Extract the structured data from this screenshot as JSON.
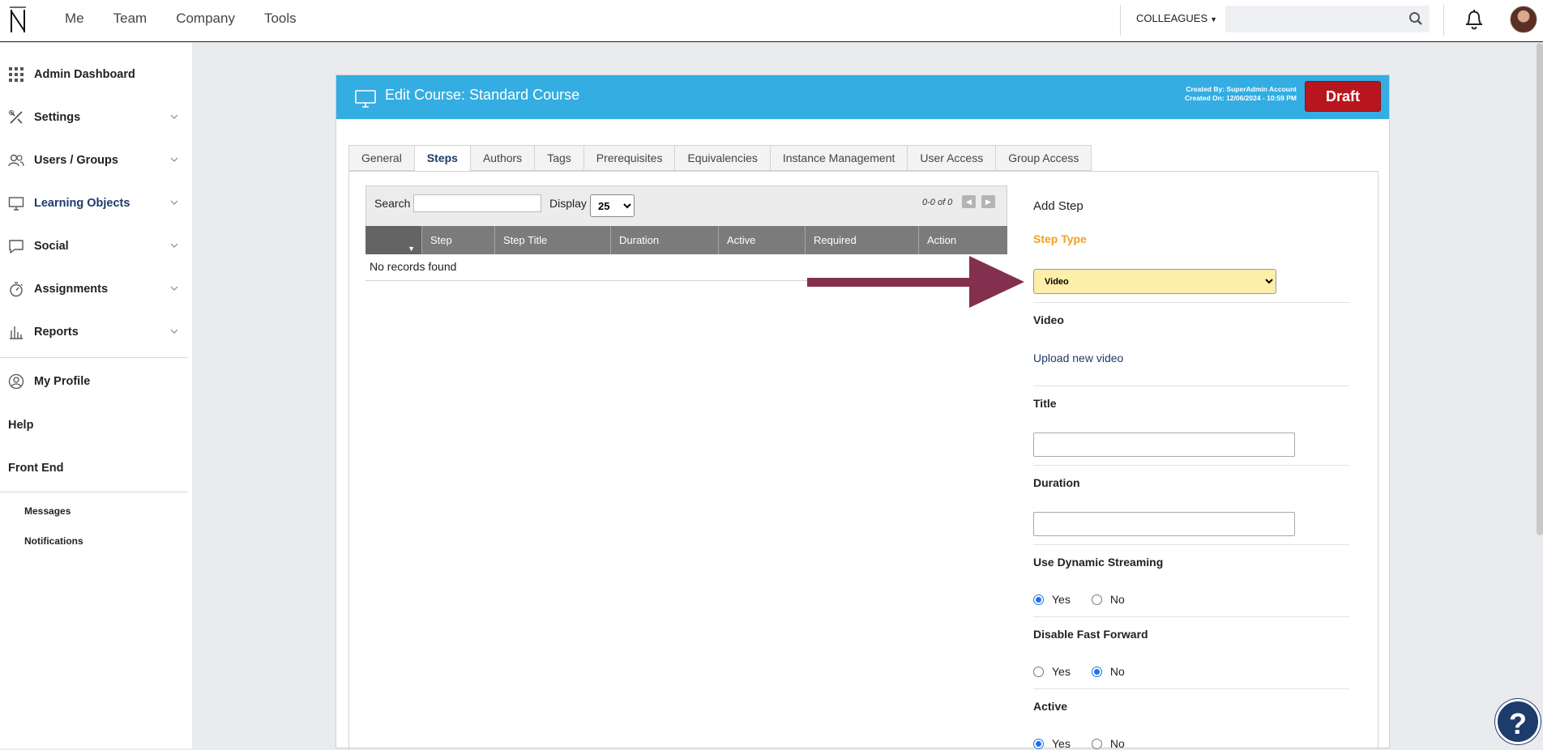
{
  "topnav": {
    "items": [
      "Me",
      "Team",
      "Company",
      "Tools"
    ],
    "colleagues_label": "COLLEAGUES",
    "search_placeholder": ""
  },
  "sidebar": {
    "items": [
      {
        "label": "Admin Dashboard",
        "icon": "grid-icon"
      },
      {
        "label": "Settings",
        "icon": "tools-icon"
      },
      {
        "label": "Users / Groups",
        "icon": "users-icon"
      },
      {
        "label": "Learning Objects",
        "icon": "monitor-icon"
      },
      {
        "label": "Social",
        "icon": "chat-icon"
      },
      {
        "label": "Assignments",
        "icon": "stopwatch-icon"
      },
      {
        "label": "Reports",
        "icon": "bar-chart-icon"
      }
    ],
    "my_profile": "My Profile",
    "help": "Help",
    "front_end": "Front End",
    "messages": "Messages",
    "notifications": "Notifications"
  },
  "panel": {
    "title": "Edit Course: Standard Course",
    "created_by": "Created By: SuperAdmin Account",
    "created_on": "Created On: 12/06/2024 - 10:59 PM",
    "status": "Draft",
    "status_color": "#b8161f",
    "header_color": "#33ade2"
  },
  "tabs": [
    "General",
    "Steps",
    "Authors",
    "Tags",
    "Prerequisites",
    "Equivalencies",
    "Instance Management",
    "User Access",
    "Group Access"
  ],
  "active_tab": "Steps",
  "grid": {
    "search_label": "Search",
    "search_value": "",
    "display_label": "Display",
    "display_value": "25",
    "pager": "0-0 of 0",
    "columns": [
      "",
      "Step",
      "Step Title",
      "Duration",
      "Active",
      "Required",
      "Action"
    ],
    "empty_text": "No records found"
  },
  "add_step": {
    "heading": "Add Step",
    "step_type_label": "Step Type",
    "step_type_value": "Video",
    "video_label": "Video",
    "upload_link": "Upload new video",
    "title_label": "Title",
    "title_value": "",
    "duration_label": "Duration",
    "duration_value": "",
    "dynamic_label": "Use Dynamic Streaming",
    "dynamic_value": "Yes",
    "fastforward_label": "Disable Fast Forward",
    "fastforward_value": "No",
    "active_label": "Active",
    "active_value": "Yes",
    "yes": "Yes",
    "no": "No"
  },
  "help_fab": "?"
}
